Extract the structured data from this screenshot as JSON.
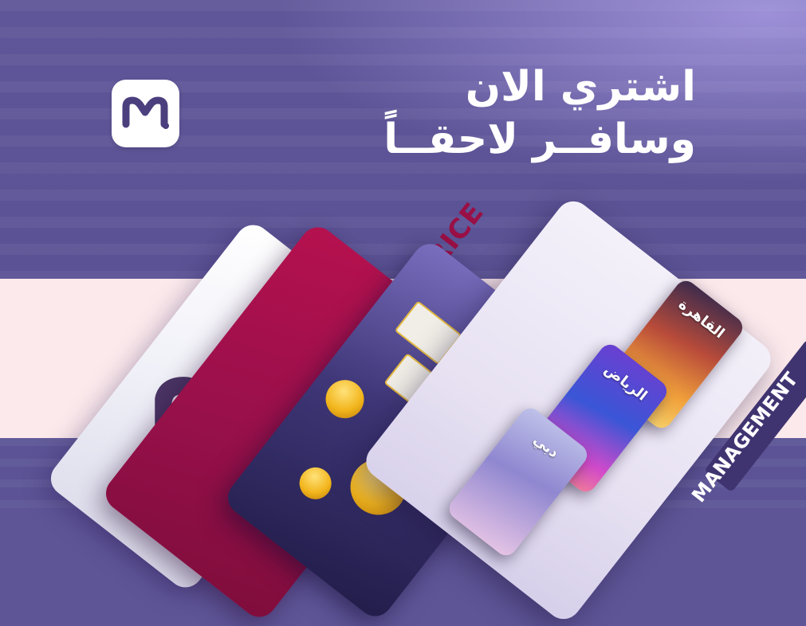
{
  "brand": {
    "logo_icon": "m-dot-logo-icon",
    "accent_color": "#5e5597",
    "highlight_color": "#9a0f45"
  },
  "headline": {
    "line1": "اشتري الان",
    "line2": "وسافــر لاحقــاً"
  },
  "cards": {
    "last_price": "LAST PRICE",
    "management": "MANAGEMENT"
  },
  "cities": [
    "القاهرة",
    "الرياض",
    "دبي"
  ]
}
